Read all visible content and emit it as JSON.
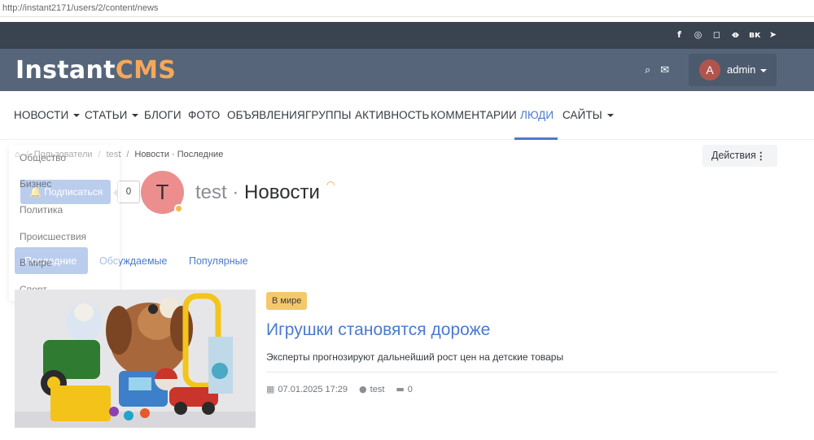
{
  "browser": {
    "url": "http://instant2171/users/2/content/news"
  },
  "social_icons": [
    "facebook-icon",
    "github-icon",
    "instagram-icon",
    "odnoklassniki-icon",
    "vk-icon",
    "telegram-icon"
  ],
  "social_glyphs": [
    "f",
    "◎",
    "◻",
    "ꝋ",
    "вк",
    "➤"
  ],
  "logo": {
    "part1": "Instant",
    "part2": "CMS"
  },
  "header": {
    "search_glyph": "⌕",
    "mail_glyph": "✉",
    "avatar_letter": "A",
    "username": "admin"
  },
  "nav": [
    {
      "label": "НОВОСТИ",
      "dropdown": true
    },
    {
      "label": "СТАТЬИ",
      "dropdown": true
    },
    {
      "label": "БЛОГИ"
    },
    {
      "label": "ФОТО"
    },
    {
      "label": "ОБЪЯВЛЕНИЯ"
    },
    {
      "label": "ГРУППЫ"
    },
    {
      "label": "АКТИВНОСТЬ"
    },
    {
      "label": "КОММЕНТАРИИ"
    },
    {
      "label": "ЛЮДИ",
      "active": true
    },
    {
      "label": "САЙТЫ",
      "dropdown": true
    }
  ],
  "breadcrumb": [
    "Пользователи",
    "test",
    "Новости · Последние"
  ],
  "actions_label": "Действия",
  "actions_dots": "⋮",
  "subscribe_label": "Подписаться",
  "subscribers_count": "0",
  "profile": {
    "avatar_letter": "T",
    "user": "test",
    "separator": "·",
    "section": "Новости"
  },
  "tabs": [
    "Последние",
    "Обсуждаемые",
    "Популярные"
  ],
  "categories_dropdown": [
    "Общество",
    "Бизнес",
    "Политика",
    "Происшествия",
    "В мире",
    "Спорт"
  ],
  "article": {
    "category": "В мире",
    "title": "Игрушки становятся дороже",
    "description": "Эксперты прогнозируют дальнейший рост цен на детские товары",
    "date": "07.01.2025 17:29",
    "author": "test",
    "comments": "0"
  },
  "colors": {
    "accent": "#4a7ad0",
    "header_bg": "#56657a",
    "topbar_bg": "#3a4350",
    "logo_accent": "#f5a85a",
    "badge": "#f5c86b"
  }
}
